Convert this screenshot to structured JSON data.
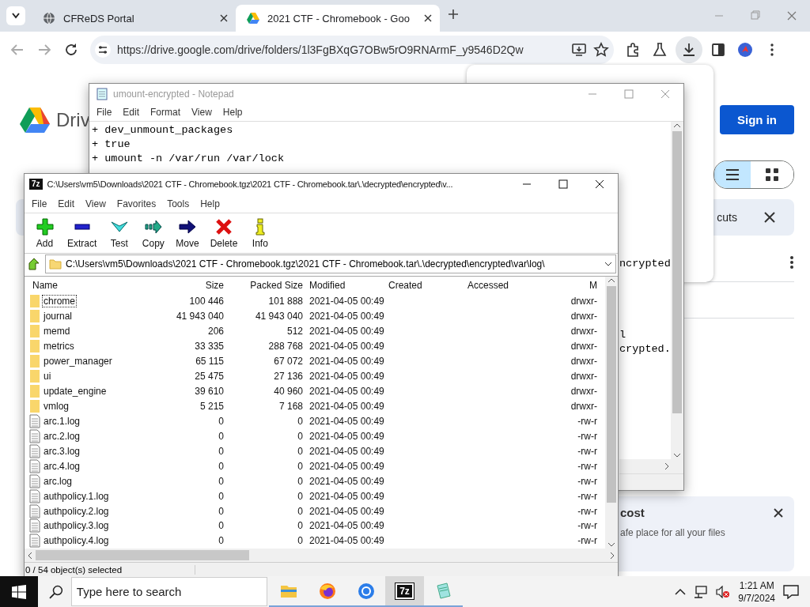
{
  "browser": {
    "tabs": [
      {
        "label": "CFReDS Portal",
        "kind": "globe",
        "selected": false
      },
      {
        "label": "2021 CTF - Chromebook - Goo",
        "kind": "drive",
        "selected": true
      }
    ],
    "url": "https://drive.google.com/drive/folders/1l3FgBXqG7OBw5rO9RNArmF_y9546D2Qw"
  },
  "drive": {
    "logo_text": "Driv",
    "sign_in": "Sign in",
    "view_toggle": [
      {
        "kind": "list",
        "selected": true
      },
      {
        "kind": "grid",
        "selected": false
      }
    ],
    "banner_text": "cuts",
    "storage_card": {
      "title": "cost",
      "text": "afe place for all your files"
    }
  },
  "notepad": {
    "title": "umount-encrypted - Notepad",
    "menu": [
      "File",
      "Edit",
      "Format",
      "View",
      "Help"
    ],
    "lines": [
      "+ dev_unmount_packages",
      "+ true",
      "+ umount -n /var/run /var/lock"
    ],
    "fragments": [
      "ncrypted",
      "l",
      "crypted."
    ]
  },
  "archive": {
    "icon_text": "7z",
    "title": "C:\\Users\\vm5\\Downloads\\2021 CTF - Chromebook.tgz\\2021 CTF - Chromebook.tar\\.\\decrypted\\encrypted\\v...",
    "menu": [
      "File",
      "Edit",
      "View",
      "Favorites",
      "Tools",
      "Help"
    ],
    "tools": [
      {
        "kind": "add",
        "label": "Add"
      },
      {
        "kind": "extract",
        "label": "Extract"
      },
      {
        "kind": "test",
        "label": "Test"
      },
      {
        "kind": "copy",
        "label": "Copy"
      },
      {
        "kind": "move",
        "label": "Move"
      },
      {
        "kind": "delete",
        "label": "Delete"
      },
      {
        "kind": "info",
        "label": "Info"
      }
    ],
    "path": "C:\\Users\\vm5\\Downloads\\2021 CTF - Chromebook.tgz\\2021 CTF - Chromebook.tar\\.\\decrypted\\encrypted\\var\\log\\",
    "columns": [
      "Name",
      "Size",
      "Packed Size",
      "Modified",
      "Created",
      "Accessed",
      "M"
    ],
    "rows": [
      {
        "kind": "folder",
        "name": "chrome",
        "size": "100 446",
        "packed": "101 888",
        "modified": "2021-04-05 00:49",
        "attributes": "drwxr-",
        "focused": true
      },
      {
        "kind": "folder",
        "name": "journal",
        "size": "41 943 040",
        "packed": "41 943 040",
        "modified": "2021-04-05 00:49",
        "attributes": "drwxr-",
        "focused": false
      },
      {
        "kind": "folder",
        "name": "memd",
        "size": "206",
        "packed": "512",
        "modified": "2021-04-05 00:49",
        "attributes": "drwxr-",
        "focused": false
      },
      {
        "kind": "folder",
        "name": "metrics",
        "size": "33 335",
        "packed": "288 768",
        "modified": "2021-04-05 00:49",
        "attributes": "drwxr-",
        "focused": false
      },
      {
        "kind": "folder",
        "name": "power_manager",
        "size": "65 115",
        "packed": "67 072",
        "modified": "2021-04-05 00:49",
        "attributes": "drwxr-",
        "focused": false
      },
      {
        "kind": "folder",
        "name": "ui",
        "size": "25 475",
        "packed": "27 136",
        "modified": "2021-04-05 00:49",
        "attributes": "drwxr-",
        "focused": false
      },
      {
        "kind": "folder",
        "name": "update_engine",
        "size": "39 610",
        "packed": "40 960",
        "modified": "2021-04-05 00:49",
        "attributes": "drwxr-",
        "focused": false
      },
      {
        "kind": "folder",
        "name": "vmlog",
        "size": "5 215",
        "packed": "7 168",
        "modified": "2021-04-05 00:49",
        "attributes": "drwxr-",
        "focused": false
      },
      {
        "kind": "file",
        "name": "arc.1.log",
        "size": "0",
        "packed": "0",
        "modified": "2021-04-05 00:49",
        "attributes": "-rw-r",
        "focused": false
      },
      {
        "kind": "file",
        "name": "arc.2.log",
        "size": "0",
        "packed": "0",
        "modified": "2021-04-05 00:49",
        "attributes": "-rw-r",
        "focused": false
      },
      {
        "kind": "file",
        "name": "arc.3.log",
        "size": "0",
        "packed": "0",
        "modified": "2021-04-05 00:49",
        "attributes": "-rw-r",
        "focused": false
      },
      {
        "kind": "file",
        "name": "arc.4.log",
        "size": "0",
        "packed": "0",
        "modified": "2021-04-05 00:49",
        "attributes": "-rw-r",
        "focused": false
      },
      {
        "kind": "file",
        "name": "arc.log",
        "size": "0",
        "packed": "0",
        "modified": "2021-04-05 00:49",
        "attributes": "-rw-r",
        "focused": false
      },
      {
        "kind": "file",
        "name": "authpolicy.1.log",
        "size": "0",
        "packed": "0",
        "modified": "2021-04-05 00:49",
        "attributes": "-rw-r",
        "focused": false
      },
      {
        "kind": "file",
        "name": "authpolicy.2.log",
        "size": "0",
        "packed": "0",
        "modified": "2021-04-05 00:49",
        "attributes": "-rw-r",
        "focused": false
      },
      {
        "kind": "file",
        "name": "authpolicy.3.log",
        "size": "0",
        "packed": "0",
        "modified": "2021-04-05 00:49",
        "attributes": "-rw-r",
        "focused": false
      },
      {
        "kind": "file",
        "name": "authpolicy.4.log",
        "size": "0",
        "packed": "0",
        "modified": "2021-04-05 00:49",
        "attributes": "-rw-r",
        "focused": false
      }
    ],
    "status": "0 / 54 object(s) selected"
  },
  "taskbar": {
    "search_placeholder": "Type here to search",
    "apps": [
      {
        "kind": "explorer",
        "selected": false
      },
      {
        "kind": "firefox",
        "selected": false
      },
      {
        "kind": "chrome",
        "selected": false
      },
      {
        "kind": "sevenzip",
        "label": "7z",
        "selected": true
      },
      {
        "kind": "notepad",
        "selected": false
      }
    ],
    "time": "1:21 AM",
    "date": "9/7/2024"
  }
}
